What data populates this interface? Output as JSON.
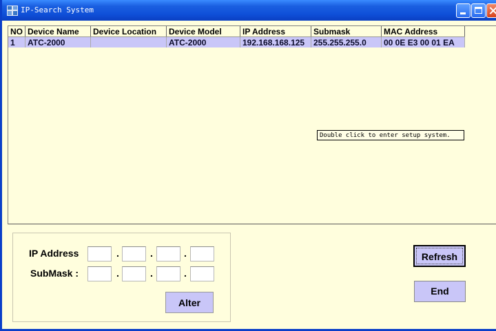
{
  "window": {
    "title": "IP-Search System"
  },
  "list": {
    "columns": [
      "NO",
      "Device Name",
      "Device Location",
      "Device Model",
      "IP Address",
      "Submask",
      "MAC Address"
    ],
    "rows": [
      {
        "no": "1",
        "device_name": "ATC-2000",
        "device_location": "",
        "device_model": "ATC-2000",
        "ip_address": "192.168.168.125",
        "submask": "255.255.255.0",
        "mac_address": "00 0E E3 00 01 EA",
        "selected": true
      }
    ]
  },
  "tooltip": "Double click to enter setup system.",
  "form": {
    "ip_label": "IP Address",
    "submask_label": "SubMask :",
    "ip_segments": [
      "",
      "",
      "",
      ""
    ],
    "submask_segments": [
      "",
      "",
      "",
      ""
    ],
    "separator": "."
  },
  "buttons": {
    "alter": "Alter",
    "refresh": "Refresh",
    "end": "End"
  },
  "colors": {
    "titlebar": "#0f4fd8",
    "background": "#fffedd",
    "selection": "#c9c6f8",
    "button": "#c9c6f8"
  },
  "icons": {
    "app": "app-icon",
    "minimize": "minimize-icon",
    "maximize": "maximize-icon",
    "close": "close-icon"
  }
}
